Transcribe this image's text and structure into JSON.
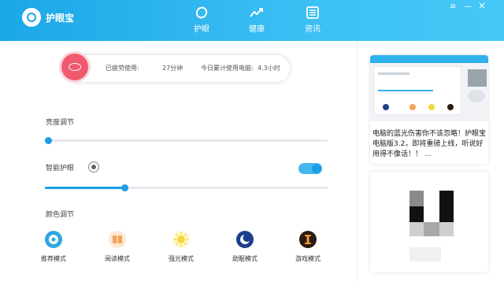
{
  "app": {
    "title": "护眼宝"
  },
  "nav": [
    {
      "label": "护眼",
      "icon": "eye-shape-icon"
    },
    {
      "label": "健康",
      "icon": "trend-line-icon"
    },
    {
      "label": "资讯",
      "icon": "news-list-icon"
    }
  ],
  "window_controls": {
    "menu": "≡",
    "minimize": "—",
    "close": "×"
  },
  "status": {
    "fatigue_label": "已疲劳使用:",
    "fatigue_value": "27分钟",
    "today_label": "今日累计使用电脑:",
    "today_value": "4.3小时"
  },
  "brightness": {
    "label": "亮度调节",
    "level_fraction": 0.01
  },
  "smart_eye": {
    "label": "智能护眼",
    "enabled": true,
    "level_fraction": 0.28
  },
  "color": {
    "label": "颜色调节",
    "modes": [
      {
        "label": "推荐模式",
        "icon": "recommend-face-icon",
        "color": "#2ea7e0"
      },
      {
        "label": "阅读模式",
        "icon": "book-icon",
        "color": "#f2a35b"
      },
      {
        "label": "强光模式",
        "icon": "sun-icon",
        "color": "#f7d83a"
      },
      {
        "label": "助眠模式",
        "icon": "moon-icon",
        "color": "#1c3f8c"
      },
      {
        "label": "游戏模式",
        "icon": "game-icon",
        "color": "#2b1a12"
      }
    ]
  },
  "news": {
    "text": "电脑的蓝光伤害你不该忽略！护眼宝电脑版3.2，即将重磅上线，听说好用得不像话！！ ..."
  },
  "colors": {
    "accent": "#1a9ee6",
    "header": "#2bb3ee",
    "alert": "#ef5a6f"
  }
}
